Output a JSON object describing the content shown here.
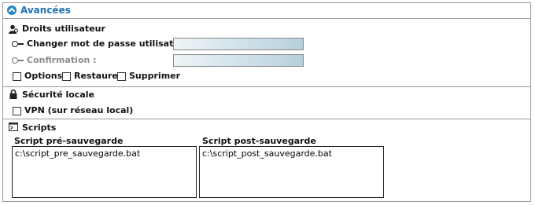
{
  "header": {
    "title": "Avancées"
  },
  "rights": {
    "title": "Droits utilisateur",
    "password_label": "Changer mot de passe utilisateur :",
    "confirm_label": "Confirmation :",
    "checkboxes": [
      {
        "label": "Options",
        "checked": false
      },
      {
        "label": "Restaurer",
        "checked": false
      },
      {
        "label": "Supprimer",
        "checked": false
      }
    ]
  },
  "security": {
    "title": "Sécurité locale",
    "vpn_label": "VPN (sur réseau local)",
    "vpn_checked": false
  },
  "scripts": {
    "title": "Scripts",
    "pre_label": "Script pré-sauvegarde",
    "pre_value": "c:\\script_pre_sauvegarde.bat",
    "post_label": "Script post-sauvegarde",
    "post_value": "c:\\script_post_sauvegarde.bat"
  },
  "colors": {
    "accent": "#2a87c8",
    "title_text": "#1f72b8"
  }
}
